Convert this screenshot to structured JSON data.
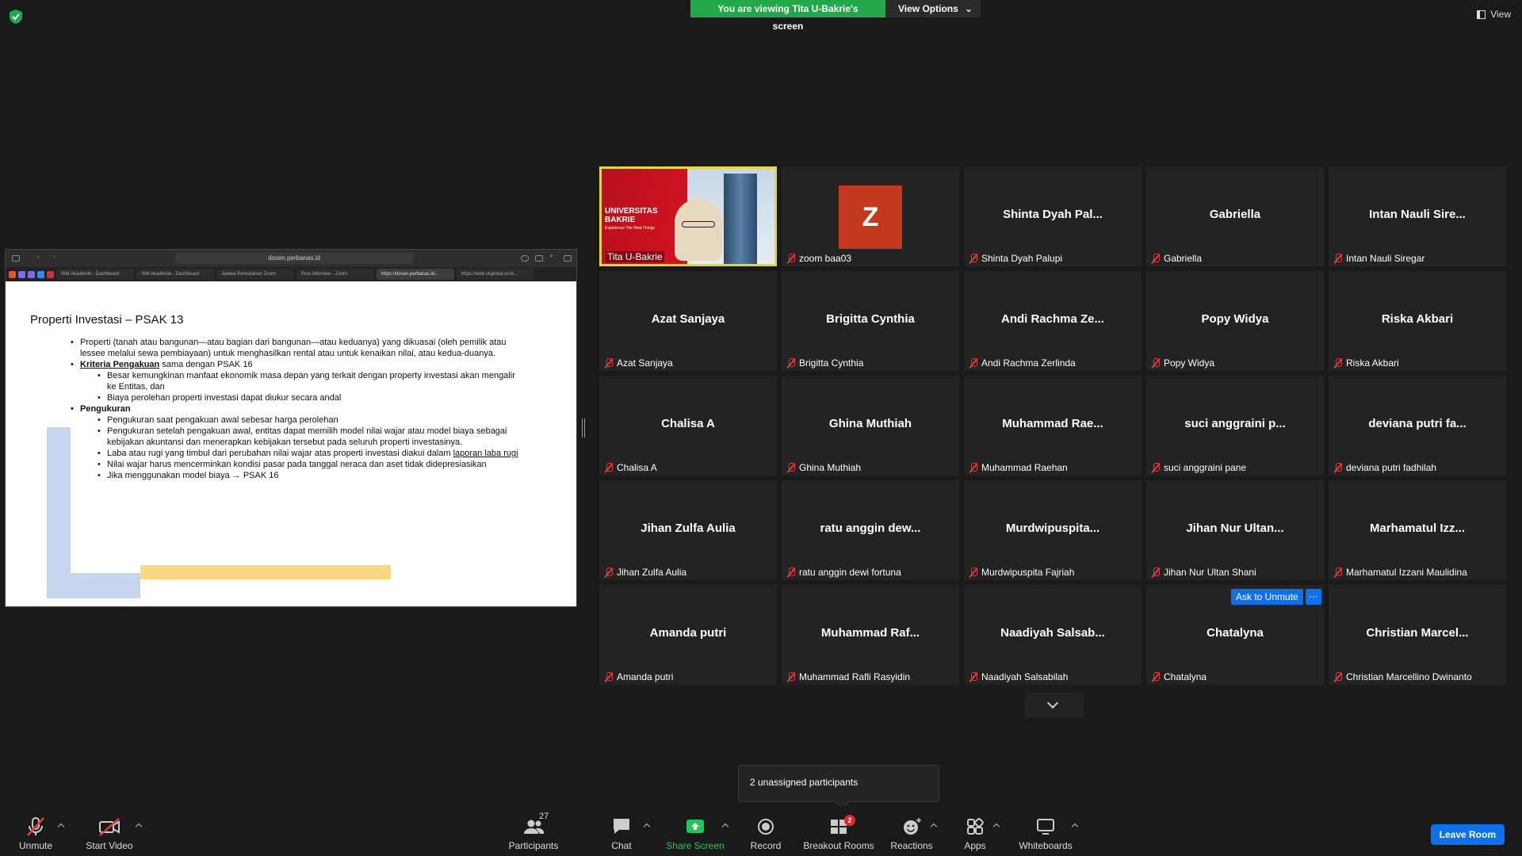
{
  "banner": {
    "viewing": "You are viewing Tita U-Bakrie's screen",
    "view_options": "View Options"
  },
  "view_button": "View",
  "browser": {
    "url": "dosen.perbanas.id",
    "tabs": [
      "SIM Akademik - Dashboard",
      "SIM Akademik - Dashboard",
      "Jadwal Perkuliahan Zoom",
      "Post Attendee - Zoom",
      "https://dosen.perbanas.id...",
      "https://web.skglobal.or.id..."
    ]
  },
  "slide": {
    "title": "Properti  Investasi – PSAK 13",
    "p1": "Properti (tanah atau bangunan—atau bagian dari bangunan—atau keduanya) yang dikuasai (oleh pemilik atau lessee melalui sewa pembiayaan) untuk menghasilkan rental atau untuk kenaikan nilai, atau kedua-duanya.",
    "p2_head": "Kriteria Pengakuan",
    "p2_tail": " sama dengan PSAK 16",
    "p2_a": "Besar kemungkinan manfaat ekonomik masa depan yang terkait dengan property investasi akan mengalir ke Entitas, dan",
    "p2_b": "Biaya perolehan properti investasi dapat diukur secara andal",
    "p3_head": "Pengukuran",
    "p3_a": "Pengukuran saat pengakuan awal sebesar harga perolehan",
    "p3_b": "Pengukuran setelah pengakuan awal, entitas dapat memilih model nilai wajar atau model biaya sebagai kebijakan akuntansi dan menerapkan kebijakan tersebut pada seluruh properti investasinya.",
    "p3_c1": "Laba atau rugi yang timbul dari perubahan nilai wajar atas properti investasi diakui dalam ",
    "p3_c2": "laporan laba rugi",
    "p3_d": "Nilai wajar harus mencerminkan kondisi pasar pada tanggal neraca dan aset tidak didepresiasikan",
    "p3_e": "Jika menggunakan model biaya → PSAK 16"
  },
  "video_tile": {
    "name": "Tita U-Bakrie",
    "line1": "UNIVERSITAS",
    "line2": "BAKRIE",
    "line3": "Experience The Real Things"
  },
  "participants": [
    {
      "center": "Z",
      "label": "zoom baa03",
      "avatar": true
    },
    {
      "center": "Shinta  Dyah  Pal...",
      "label": "Shinta Dyah Palupi"
    },
    {
      "center": "Gabriella",
      "label": "Gabriella"
    },
    {
      "center": "Intan  Nauli  Sire...",
      "label": "Intan Nauli Siregar"
    },
    {
      "center": "Azat Sanjaya",
      "label": "Azat Sanjaya"
    },
    {
      "center": "Brigitta Cynthia",
      "label": "Brigitta Cynthia"
    },
    {
      "center": "Andi  Rachma  Ze...",
      "label": "Andi Rachma Zerlinda"
    },
    {
      "center": "Popy Widya",
      "label": "Popy Widya"
    },
    {
      "center": "Riska Akbari",
      "label": "Riska Akbari"
    },
    {
      "center": "Chalisa A",
      "label": "Chalisa A"
    },
    {
      "center": "Ghina Muthiah",
      "label": "Ghina Muthiah"
    },
    {
      "center": "Muhammad  Rae...",
      "label": "Muhammad Raehan"
    },
    {
      "center": "suci  anggraini  p...",
      "label": "suci anggraini pane"
    },
    {
      "center": "deviana  putri  fa...",
      "label": "deviana putri fadhilah"
    },
    {
      "center": "Jihan Zulfa Aulia",
      "label": "Jihan Zulfa Aulia"
    },
    {
      "center": "ratu  anggin  dew...",
      "label": "ratu anggin dewi fortuna"
    },
    {
      "center": "Murdwipuspita...",
      "label": "Murdwipuspita Fajriah"
    },
    {
      "center": "Jihan  Nur  Ultan...",
      "label": "Jihan Nur Ultan Shani"
    },
    {
      "center": "Marhamatul  Izz...",
      "label": "Marhamatul Izzani Maulidina"
    },
    {
      "center": "Amanda putri",
      "label": "Amanda putri"
    },
    {
      "center": "Muhammad  Raf...",
      "label": "Muhammad Rafli Rasyidin"
    },
    {
      "center": "Naadiyah  Salsab...",
      "label": "Naadiyah Salsabilah"
    },
    {
      "center": "Chatalyna",
      "label": "Chatalyna"
    },
    {
      "center": "Christian  Marcel...",
      "label": "Christian Marcellino Dwinanto"
    }
  ],
  "ask_unmute": "Ask to Unmute",
  "more": "···",
  "tooltip": "2 unassigned participants",
  "toolbar": {
    "unmute": "Unmute",
    "start_video": "Start Video",
    "participants": "Participants",
    "participants_count": "27",
    "chat": "Chat",
    "share_screen": "Share Screen",
    "record": "Record",
    "breakout_rooms": "Breakout Rooms",
    "breakout_badge": "2",
    "reactions": "Reactions",
    "apps": "Apps",
    "whiteboards": "Whiteboards",
    "leave": "Leave Room"
  },
  "colors": {
    "accent": "#0e71eb",
    "green": "#22a84a",
    "muted": "#e23c3c",
    "active_border": "#e5d540"
  }
}
